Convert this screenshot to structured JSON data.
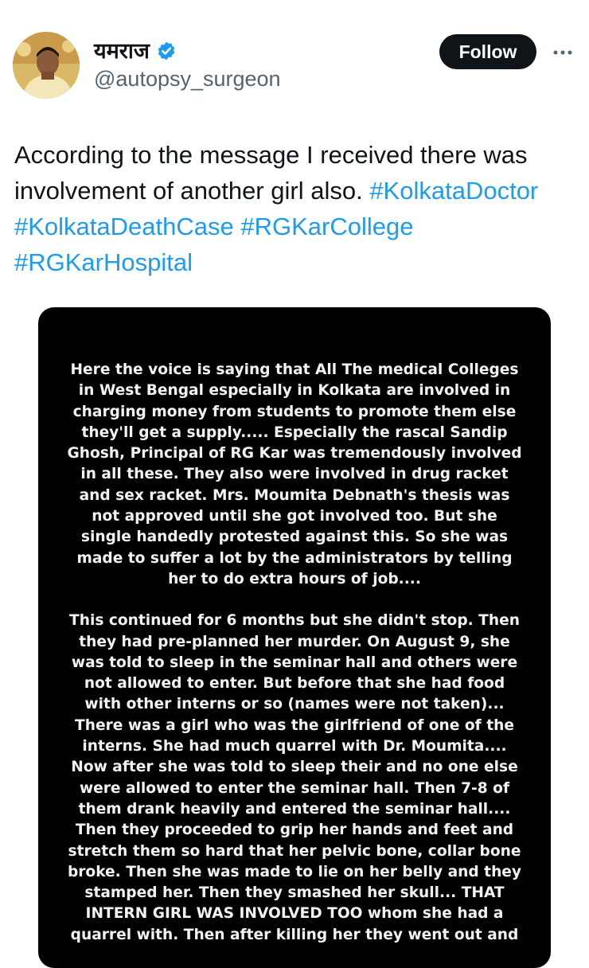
{
  "user": {
    "display_name": "यमराज",
    "handle": "@autopsy_surgeon",
    "verified_icon": "verified-badge-icon",
    "avatar": "profile-photo"
  },
  "actions": {
    "follow_label": "Follow",
    "more_icon": "more-options-icon"
  },
  "tweet": {
    "text_plain": "According to the message I received there was involvement of another girl also.",
    "hashtags": [
      "#KolkataDoctor",
      "#KolkataDeathCase",
      "#RGKarCollege",
      "#RGKarHospital"
    ]
  },
  "colors": {
    "link": "#1d9bf0",
    "text": "#0f1419",
    "secondary": "#536471",
    "button_bg": "#0f1419",
    "media_bg": "#000000"
  },
  "media": {
    "paragraph1": [
      "Here the voice is saying that All The medical Colleges",
      "in West Bengal especially in Kolkata are involved in",
      "charging money from students to promote them else",
      "they'll get a supply..... Especially the rascal Sandip",
      "Ghosh, Principal of RG Kar was tremendously involved",
      "in all these. They also were involved in drug racket",
      "and sex racket. Mrs. Moumita Debnath's thesis was",
      "not approved until she got involved too. But she",
      "single handedly protested against this. So she was",
      "made to suffer a lot by the administrators by telling",
      "her to do extra hours of job...."
    ],
    "paragraph2": [
      "This continued for 6 months but she didn't stop. Then",
      "they had pre-planned her murder. On August 9, she",
      "was told to sleep in the seminar hall and others were",
      "not allowed to enter. But before that she had food",
      "with other interns or so (names were not taken)...",
      "There was a girl who was the girlfriend of one of the",
      "interns. She had much quarrel with Dr. Moumita....",
      "Now after she was told to sleep their and no one else",
      "were allowed to enter the seminar hall. Then 7-8 of",
      "them drank heavily and entered the seminar hall....",
      "Then they proceeded to grip her hands and feet and",
      "stretch them so hard that her pelvic bone, collar bone",
      "broke. Then she was made to lie on her belly and they",
      "stamped her. Then they smashed her skull... THAT",
      "INTERN GIRL WAS INVOLVED TOO whom she had a",
      "quarrel with. Then after killing her they went out and"
    ]
  }
}
